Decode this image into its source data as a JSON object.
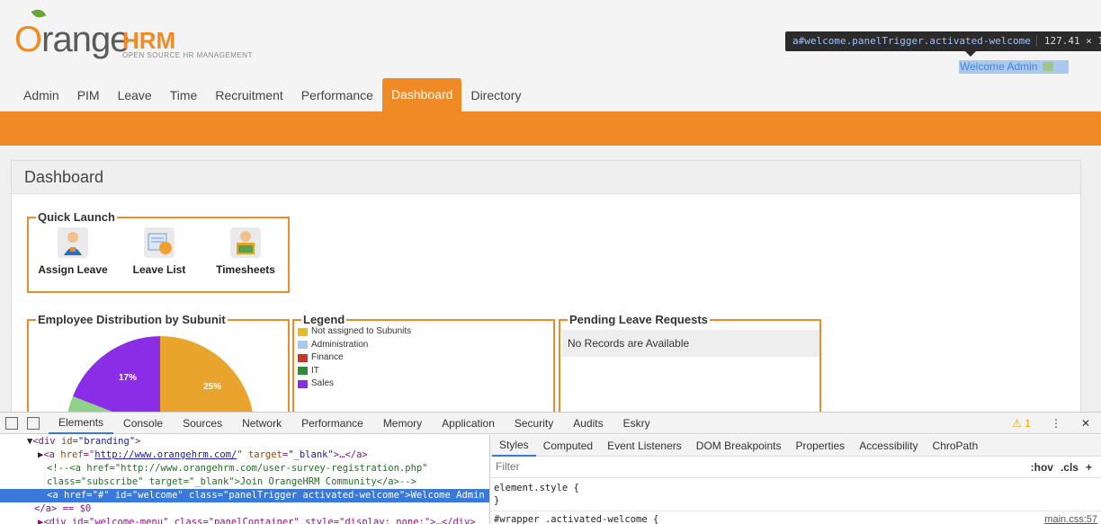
{
  "logo": {
    "word": "range",
    "hrm_h": "HRM",
    "tagline": "OPEN SOURCE HR MANAGEMENT"
  },
  "tooltip": {
    "selector": "a#welcome.panelTrigger.activated-welcome",
    "size": "127.41 × 16"
  },
  "welcome_text": "Welcome Admin",
  "nav": [
    "Admin",
    "PIM",
    "Leave",
    "Time",
    "Recruitment",
    "Performance",
    "Dashboard",
    "Directory"
  ],
  "active_nav": "Dashboard",
  "dashboard": {
    "title": "Dashboard",
    "quick_launch": {
      "title": "Quick Launch",
      "items": [
        "Assign Leave",
        "Leave List",
        "Timesheets"
      ]
    },
    "distribution": {
      "title": "Employee Distribution by Subunit",
      "slices": [
        {
          "label": "25%",
          "color": "#e8a42c",
          "value": 25
        },
        {
          "label": "17%",
          "color": "#8b2ce6",
          "value": 17
        },
        {
          "label": "",
          "color": "#8fd08a",
          "value": 8
        }
      ]
    },
    "legend": {
      "title": "Legend",
      "items": [
        {
          "label": "Not assigned to Subunits",
          "color": "#e8b923"
        },
        {
          "label": "Administration",
          "color": "#a9c9f2"
        },
        {
          "label": "Finance",
          "color": "#c0392b"
        },
        {
          "label": "IT",
          "color": "#2e8b3a"
        },
        {
          "label": "Sales",
          "color": "#8b2ce6"
        }
      ]
    },
    "pending": {
      "title": "Pending Leave Requests",
      "empty": "No Records are Available"
    }
  },
  "devtools": {
    "tabs": [
      "Elements",
      "Console",
      "Sources",
      "Network",
      "Performance",
      "Memory",
      "Application",
      "Security",
      "Audits",
      "Eskry"
    ],
    "warnings": "1",
    "dom_lines": [
      {
        "indent": "▼",
        "pre": "<div ",
        "attr": "id",
        "val": "\"branding\"",
        "post": ">"
      },
      {
        "indent": "▶",
        "pre": "<a ",
        "attr": "href",
        "link": "http://www.orangehrm.com/",
        "attr2": " target",
        "val2": "\"_blank\"",
        "post": ">…</a>"
      },
      {
        "comment": "<!--<a href=\"http://www.orangehrm.com/user-survey-registration.php\""
      },
      {
        "comment": "class=\"subscribe\" target=\"_blank\">Join OrangeHRM Community</a>-->"
      },
      {
        "selected": "<a href=\"#\" id=\"welcome\" class=\"panelTrigger activated-welcome\">Welcome Admin"
      },
      {
        "tail": "</a> == $0"
      },
      {
        "tail": "▶<div id=\"welcome-menu\" class=\"panelContainer\" style=\"display: none;\">…</div>"
      }
    ],
    "styles_tabs": [
      "Styles",
      "Computed",
      "Event Listeners",
      "DOM Breakpoints",
      "Properties",
      "Accessibility",
      "ChroPath"
    ],
    "filter_placeholder": "Filter",
    "hov": ":hov",
    "cls": ".cls",
    "plus": "+",
    "code1": "element.style {",
    "code2": "}",
    "code3": "#wrapper .activated-welcome {",
    "source": "main.css:57"
  }
}
